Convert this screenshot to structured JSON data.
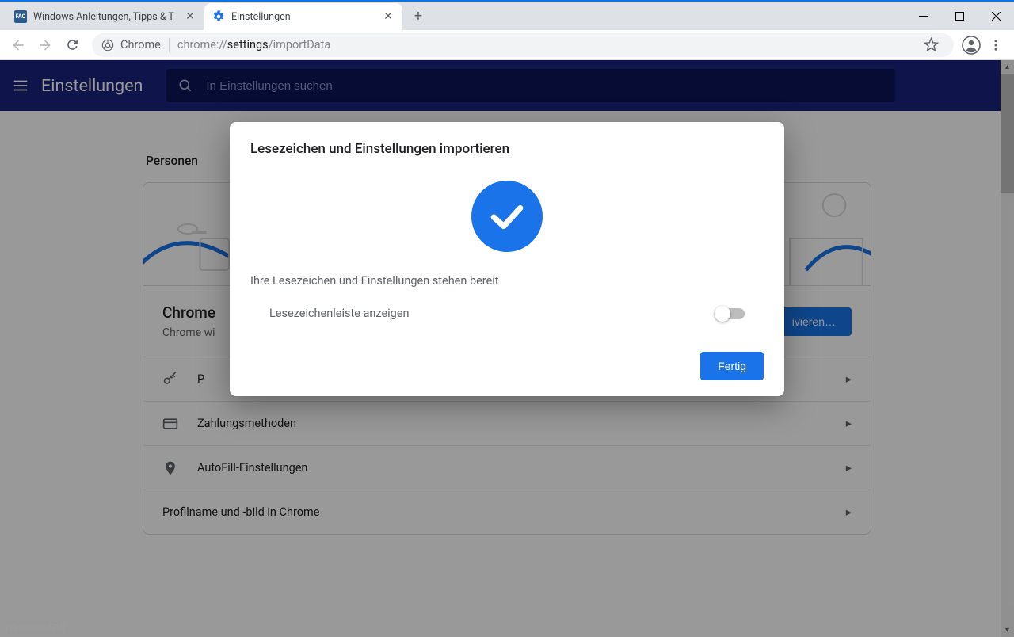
{
  "tabs": {
    "items": [
      {
        "title": "Windows Anleitungen, Tipps & T",
        "favicon": "faq"
      },
      {
        "title": "Einstellungen",
        "favicon": "gear"
      }
    ]
  },
  "toolbar": {
    "url_chrome_label": "Chrome",
    "url_scheme": "chrome://",
    "url_path_bold": "settings",
    "url_path_rest": "/importData"
  },
  "settings": {
    "page_title": "Einstellungen",
    "search_placeholder": "In Einstellungen suchen",
    "section_people": "Personen",
    "sync_heading": "Chrome",
    "sync_sub": "Chrome wi",
    "activate_label": "ivieren…",
    "rows": [
      {
        "icon": "key",
        "label": "P"
      },
      {
        "icon": "card",
        "label": "Zahlungsmethoden"
      },
      {
        "icon": "pin",
        "label": "AutoFill-Einstellungen"
      },
      {
        "icon": "",
        "label": "Profilname und -bild in Chrome"
      }
    ]
  },
  "dialog": {
    "title": "Lesezeichen und Einstellungen importieren",
    "subtitle": "Ihre Lesezeichen und Einstellungen stehen bereit",
    "toggle_label": "Lesezeichenleiste anzeigen",
    "done_label": "Fertig"
  },
  "watermark": "Windows-FAQ"
}
